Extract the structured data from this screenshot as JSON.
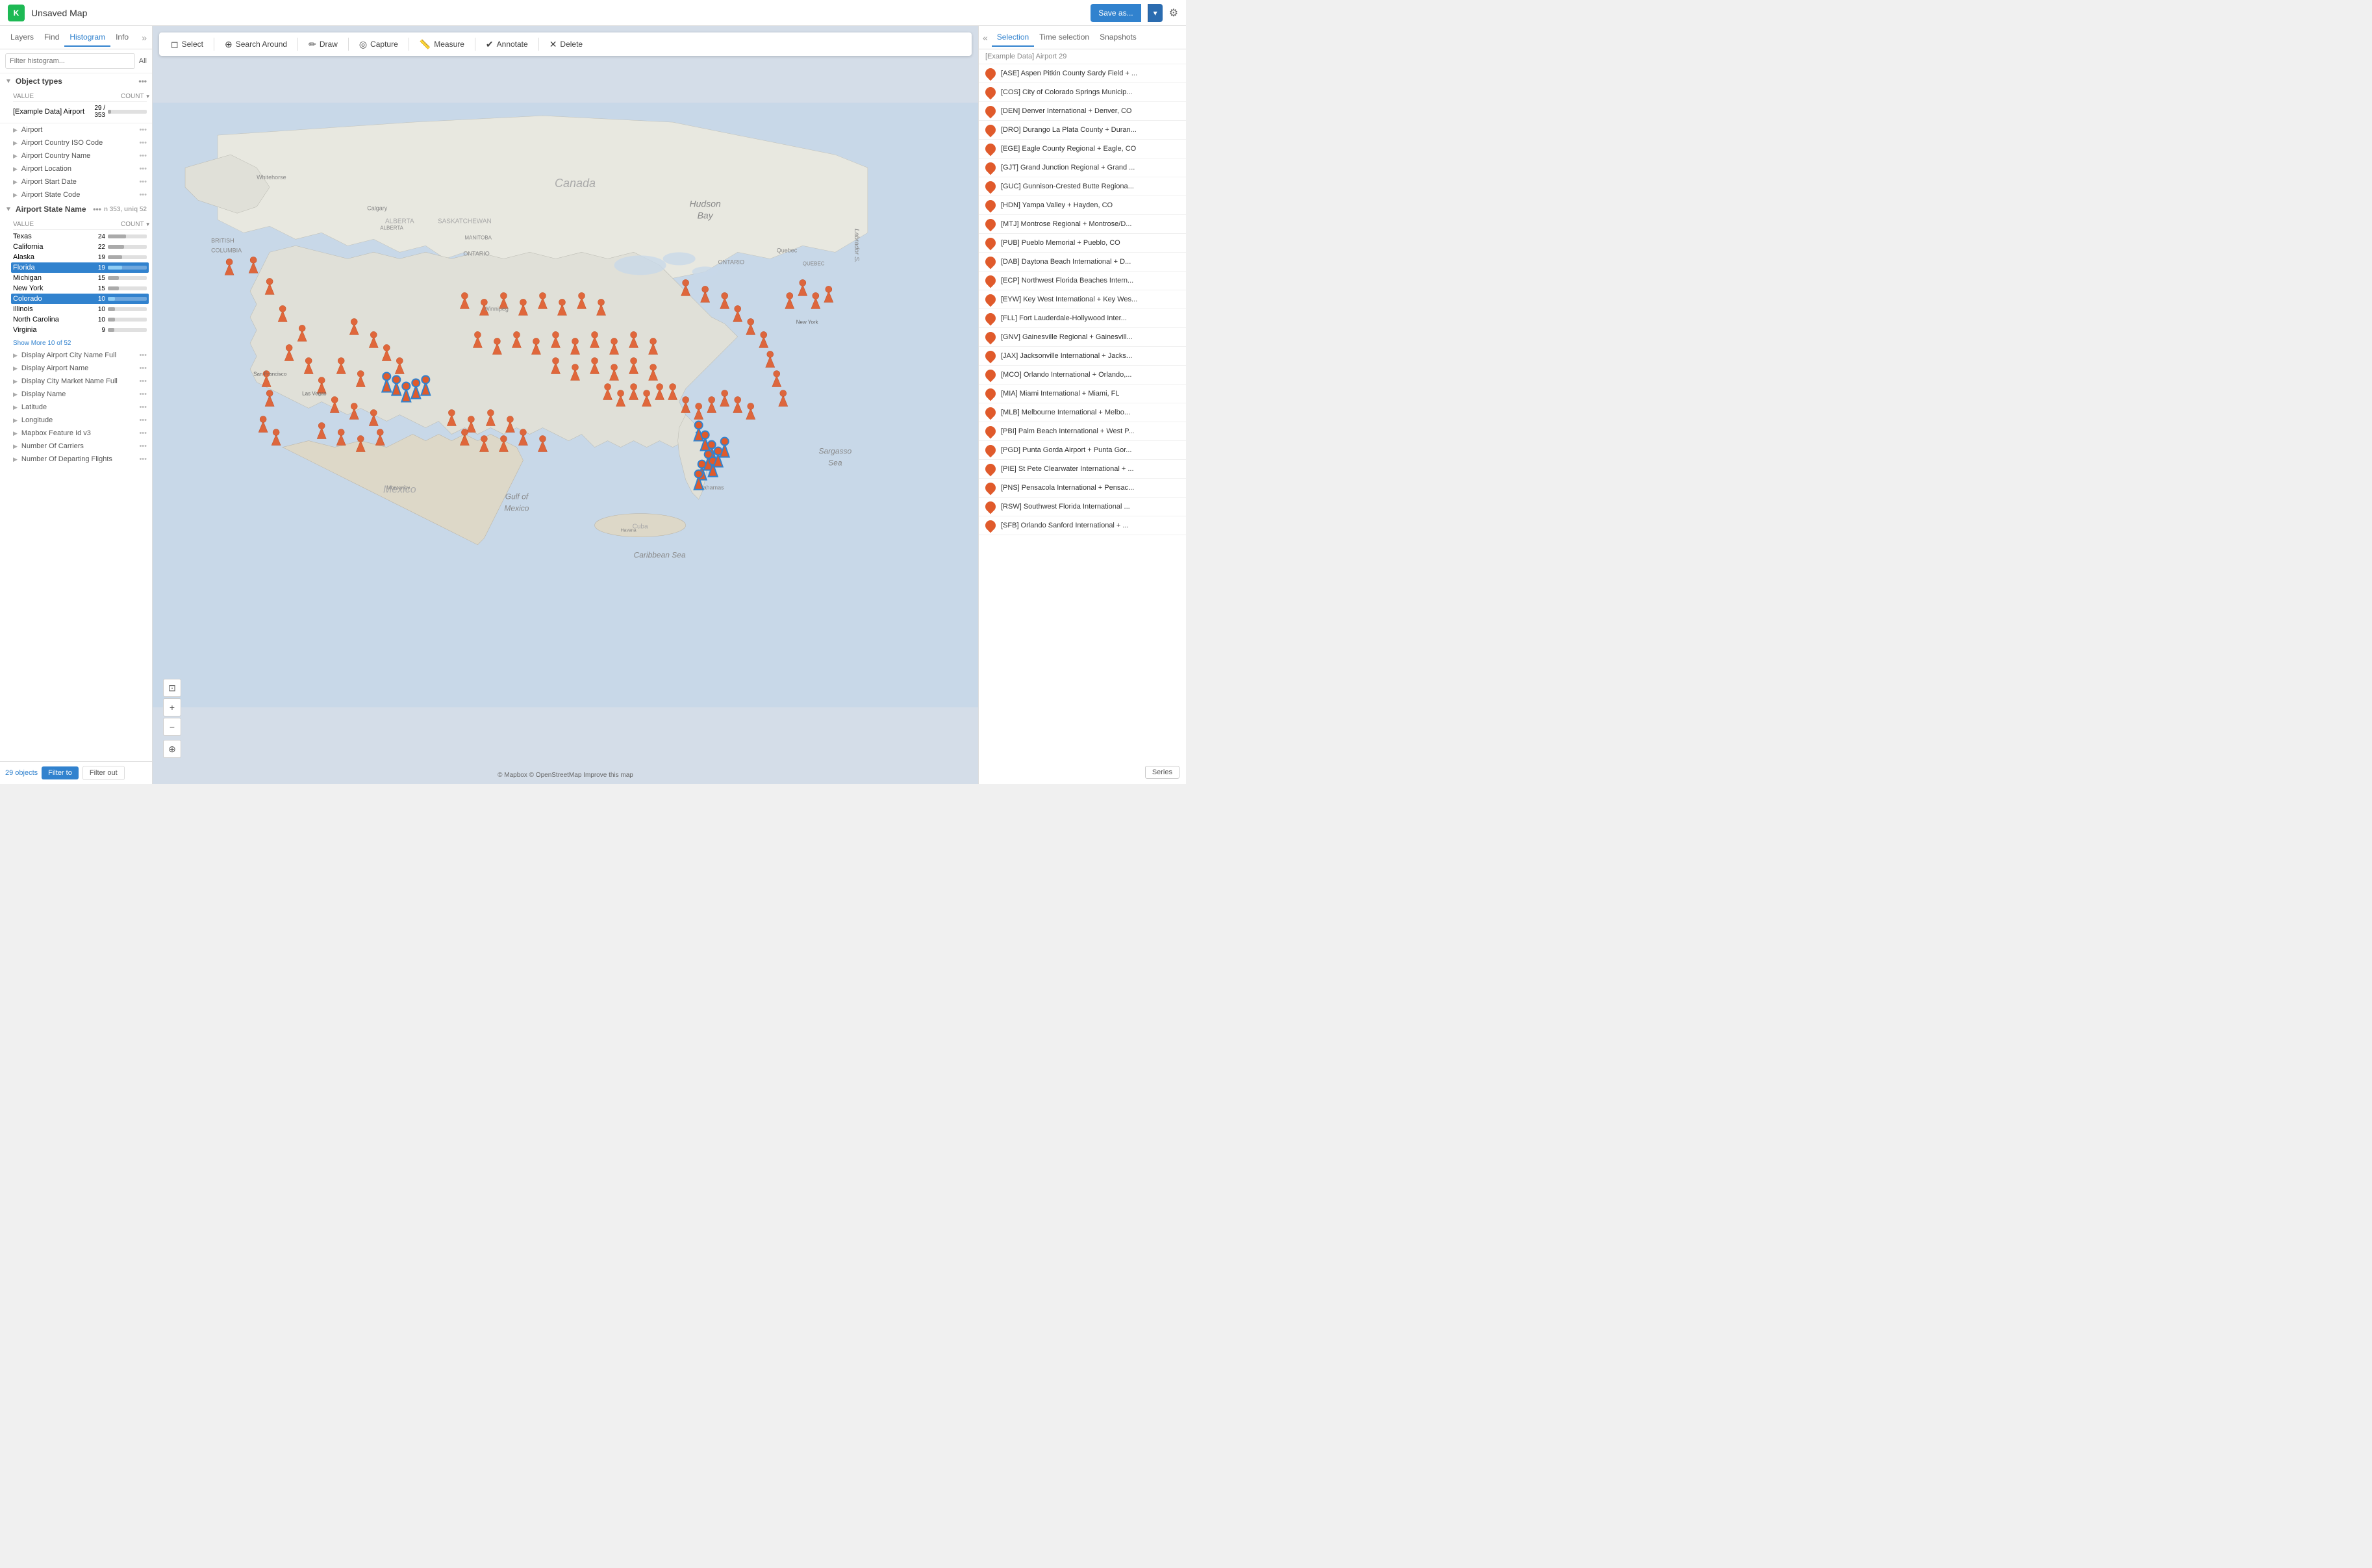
{
  "topbar": {
    "logo": "K",
    "title": "Unsaved Map",
    "save_label": "Save as...",
    "save_arrow": "▾",
    "gear_icon": "⚙"
  },
  "left_panel": {
    "tabs": [
      "Layers",
      "Find",
      "Histogram",
      "Info"
    ],
    "active_tab": "Histogram",
    "filter_placeholder": "Filter histogram...",
    "filter_all": "All",
    "sections": {
      "object_types": {
        "label": "Object types",
        "value_header": "VALUE",
        "count_header": "COUNT",
        "rows": [
          {
            "label": "[Example Data] Airport",
            "count": "29 / 353",
            "bar_pct": 8
          }
        ]
      },
      "fields": [
        {
          "label": "Airport",
          "expanded": false
        },
        {
          "label": "Airport Country ISO Code",
          "expanded": false
        },
        {
          "label": "Airport Country Name",
          "expanded": false
        },
        {
          "label": "Airport Location",
          "expanded": false
        },
        {
          "label": "Airport Start Date",
          "expanded": false
        },
        {
          "label": "Airport State Code",
          "expanded": false
        },
        {
          "label": "Airport State Name",
          "expanded": true,
          "meta": "n 353, uniq 52",
          "value_header": "VALUE",
          "count_header": "COUNT",
          "rows": [
            {
              "label": "Texas",
              "count": 24,
              "bar_pct": 46,
              "selected": false
            },
            {
              "label": "California",
              "count": 22,
              "bar_pct": 42,
              "selected": false
            },
            {
              "label": "Alaska",
              "count": 19,
              "bar_pct": 36,
              "selected": false
            },
            {
              "label": "Florida",
              "count": 19,
              "bar_pct": 36,
              "selected": true
            },
            {
              "label": "Michigan",
              "count": 15,
              "bar_pct": 29,
              "selected": false
            },
            {
              "label": "New York",
              "count": 15,
              "bar_pct": 29,
              "selected": false
            },
            {
              "label": "Colorado",
              "count": 10,
              "bar_pct": 19,
              "selected": true
            },
            {
              "label": "Illinois",
              "count": 10,
              "bar_pct": 19,
              "selected": false
            },
            {
              "label": "North Carolina",
              "count": 10,
              "bar_pct": 19,
              "selected": false
            },
            {
              "label": "Virginia",
              "count": 9,
              "bar_pct": 17,
              "selected": false
            }
          ],
          "show_more": "Show More  10 of 52"
        },
        {
          "label": "Display Airport City Name Full",
          "expanded": false
        },
        {
          "label": "Display Airport Name",
          "expanded": false
        },
        {
          "label": "Display City Market Name Full",
          "expanded": false
        },
        {
          "label": "Display Name",
          "expanded": false
        },
        {
          "label": "Latitude",
          "expanded": false
        },
        {
          "label": "Longitude",
          "expanded": false
        },
        {
          "label": "Mapbox Feature Id v3",
          "expanded": false
        },
        {
          "label": "Number Of Carriers",
          "expanded": false
        },
        {
          "label": "Number Of Departing Flights",
          "expanded": false
        }
      ]
    },
    "bottom": {
      "count": "29 objects",
      "filter_to": "Filter to",
      "filter_out": "Filter out"
    }
  },
  "toolbar": {
    "tools": [
      {
        "id": "select",
        "icon": "◻",
        "label": "Select"
      },
      {
        "id": "search-around",
        "icon": "⊕",
        "label": "Search Around"
      },
      {
        "id": "draw",
        "icon": "✏",
        "label": "Draw"
      },
      {
        "id": "capture",
        "icon": "◎",
        "label": "Capture"
      },
      {
        "id": "measure",
        "icon": "📏",
        "label": "Measure"
      },
      {
        "id": "annotate",
        "icon": "✔",
        "label": "Annotate"
      },
      {
        "id": "delete",
        "icon": "✕",
        "label": "Delete"
      }
    ]
  },
  "map": {
    "attribution": "© Mapbox © OpenStreetMap Improve this map"
  },
  "right_panel": {
    "tabs": [
      "Selection",
      "Time selection",
      "Snapshots"
    ],
    "active_tab": "Selection",
    "expand_icon": "«",
    "header": "[Example Data] Airport 29",
    "items": [
      {
        "code": "ASE",
        "label": "[ASE] Aspen Pitkin County Sardy Field + ..."
      },
      {
        "code": "COS",
        "label": "[COS] City of Colorado Springs Municip..."
      },
      {
        "code": "DEN",
        "label": "[DEN] Denver International + Denver, CO"
      },
      {
        "code": "DRO",
        "label": "[DRO] Durango La Plata County + Duran..."
      },
      {
        "code": "EGE",
        "label": "[EGE] Eagle County Regional + Eagle, CO"
      },
      {
        "code": "GJT",
        "label": "[GJT] Grand Junction Regional + Grand ..."
      },
      {
        "code": "GUC",
        "label": "[GUC] Gunnison-Crested Butte Regiona..."
      },
      {
        "code": "HDN",
        "label": "[HDN] Yampa Valley + Hayden, CO"
      },
      {
        "code": "MTJ",
        "label": "[MTJ] Montrose Regional + Montrose/D..."
      },
      {
        "code": "PUB",
        "label": "[PUB] Pueblo Memorial + Pueblo, CO"
      },
      {
        "code": "DAB",
        "label": "[DAB] Daytona Beach International + D..."
      },
      {
        "code": "ECP",
        "label": "[ECP] Northwest Florida Beaches Intern..."
      },
      {
        "code": "EYW",
        "label": "[EYW] Key West International + Key Wes..."
      },
      {
        "code": "FLL",
        "label": "[FLL] Fort Lauderdale-Hollywood Inter..."
      },
      {
        "code": "GNV",
        "label": "[GNV] Gainesville Regional + Gainesvill..."
      },
      {
        "code": "JAX",
        "label": "[JAX] Jacksonville International + Jacks..."
      },
      {
        "code": "MCO",
        "label": "[MCO] Orlando International + Orlando,..."
      },
      {
        "code": "MIA",
        "label": "[MIA] Miami International + Miami, FL"
      },
      {
        "code": "MLB",
        "label": "[MLB] Melbourne International + Melbo..."
      },
      {
        "code": "PBI",
        "label": "[PBI] Palm Beach International + West P..."
      },
      {
        "code": "PGD",
        "label": "[PGD] Punta Gorda Airport + Punta Gor..."
      },
      {
        "code": "PIE",
        "label": "[PIE] St Pete Clearwater International + ..."
      },
      {
        "code": "PNS",
        "label": "[PNS] Pensacola International + Pensac..."
      },
      {
        "code": "RSW",
        "label": "[RSW] Southwest Florida International ..."
      },
      {
        "code": "SFB",
        "label": "[SFB] Orlando Sanford International + ..."
      }
    ],
    "series_label": "Series"
  }
}
